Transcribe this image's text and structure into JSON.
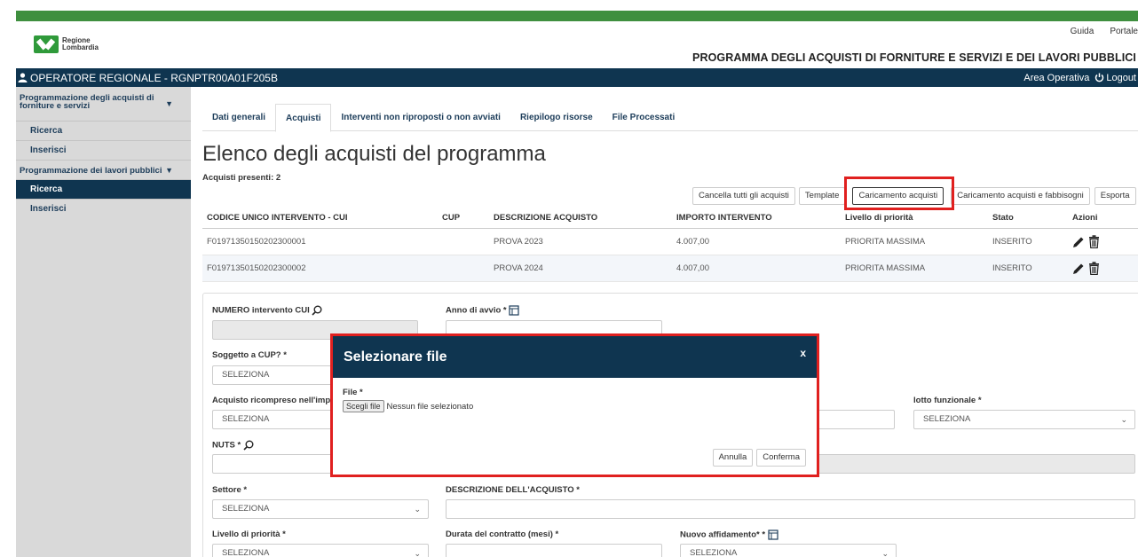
{
  "header": {
    "brand_line1": "Regione",
    "brand_line2": "Lombardia",
    "links": [
      "Guida",
      "Portale"
    ],
    "title": "PROGRAMMA DEGLI ACQUISTI DI FORNITURE E SERVIZI E DEI LAVORI PUBBLICI",
    "user": "OPERATORE REGIONALE - RGNPTR00A01F205B",
    "area": "Area Operativa",
    "logout": "Logout"
  },
  "sidebar": {
    "section1": "Programmazione degli acquisti di forniture e servizi",
    "section1_items": [
      "Ricerca",
      "Inserisci"
    ],
    "section2": "Programmazione dei lavori pubblici",
    "section2_items": [
      "Ricerca",
      "Inserisci"
    ]
  },
  "tabs": [
    "Dati generali",
    "Acquisti",
    "Interventi non riproposti o non avviati",
    "Riepilogo risorse",
    "File Processati"
  ],
  "page": {
    "heading": "Elenco degli acquisti del programma",
    "count": "Acquisti presenti: 2"
  },
  "actions": [
    "Cancella tutti gli acquisti",
    "Template",
    "Caricamento acquisti",
    "Caricamento acquisti e fabbisogni",
    "Esporta"
  ],
  "table": {
    "headers": [
      "CODICE UNICO INTERVENTO - CUI",
      "CUP",
      "DESCRIZIONE ACQUISTO",
      "IMPORTO INTERVENTO",
      "Livello di priorità",
      "Stato",
      "Azioni"
    ],
    "rows": [
      {
        "cui": "F01971350150202300001",
        "cup": "",
        "desc": "PROVA 2023",
        "importo": "4.007,00",
        "priorita": "PRIORITA MASSIMA",
        "stato": "INSERITO"
      },
      {
        "cui": "F01971350150202300002",
        "cup": "",
        "desc": "PROVA 2024",
        "importo": "4.007,00",
        "priorita": "PRIORITA MASSIMA",
        "stato": "INSERITO"
      }
    ]
  },
  "form": {
    "numero_cui": "NUMERO intervento CUI",
    "anno_avvio": "Anno di avvio *",
    "soggetto_cup": "Soggetto a CUP? *",
    "acquisto_ricompreso": "Acquisto ricompreso nell'impo",
    "lotto": "lotto funzionale *",
    "nuts": "NUTS *",
    "settore": "Settore *",
    "descrizione": "DESCRIZIONE DELL'ACQUISTO *",
    "livello": "Livello di priorità *",
    "durata": "Durata del contratto (mesi) *",
    "nuovo_affidamento": "Nuovo affidamento* *",
    "seleziona": "SELEZIONA"
  },
  "modal": {
    "title": "Selezionare file",
    "close": "x",
    "file_label": "File *",
    "choose": "Scegli file",
    "no_file": "Nessun file selezionato",
    "cancel": "Annulla",
    "confirm": "Conferma"
  }
}
